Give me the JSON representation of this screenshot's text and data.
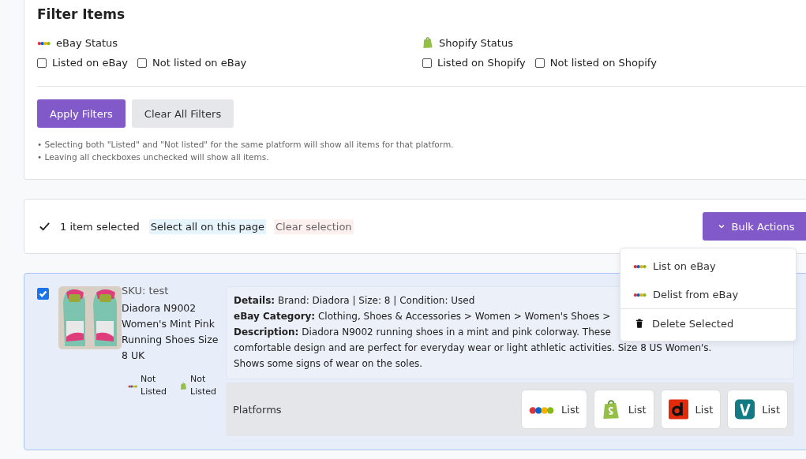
{
  "filter": {
    "title": "Filter Items",
    "groups": [
      {
        "kind": "ebay",
        "label": "eBay Status",
        "options": [
          {
            "label": "Listed on eBay",
            "checked": false
          },
          {
            "label": "Not listed on eBay",
            "checked": false
          }
        ]
      },
      {
        "kind": "shopify",
        "label": "Shopify Status",
        "options": [
          {
            "label": "Listed on Shopify",
            "checked": false
          },
          {
            "label": "Not listed on Shopify",
            "checked": false
          }
        ]
      }
    ],
    "buttons": [
      {
        "label": "Apply Filters",
        "kind": "primary"
      },
      {
        "label": "Clear All Filters",
        "kind": "secondary"
      }
    ],
    "notes": [
      "• Selecting both \"Listed\" and \"Not listed\" for the same platform will show all items for that platform.",
      "• Leaving all checkboxes unchecked will show all items."
    ]
  },
  "selection": {
    "count_text": "1 item selected",
    "select_all": "Select all on this page",
    "clear": "Clear selection",
    "bulk_button": "Bulk Actions",
    "expanded": true
  },
  "bulk_menu": [
    {
      "kind": "ebay",
      "label": "List on eBay"
    },
    {
      "kind": "ebay",
      "label": "Delist from eBay"
    },
    {
      "kind": "trash",
      "label": "Delete Selected"
    }
  ],
  "item": {
    "selected": true,
    "sku": "SKU: test",
    "title": "Diadora N9002 Women's Mint Pink Running Shoes Size 8 UK",
    "statuses": [
      {
        "kind": "ebay",
        "text": "Not Listed"
      },
      {
        "kind": "shopify",
        "text": "Not Listed"
      }
    ],
    "details": [
      "**Details:** Brand: Diadora | Size: 8 | Condition: Used",
      "**eBay Category:** Clothing, Shoes & Accessories > Women > Women's Shoes >",
      "**Description:** Diadora N9002 running shoes in a mint and pink colorway. These",
      "comfortable design and are perfect for everyday wear or light athletic activities. Size 8 US Women's.",
      "Shows some signs of wear on the soles."
    ],
    "platforms_label": "Platforms",
    "platforms": [
      {
        "kind": "ebay",
        "label": "List"
      },
      {
        "kind": "shopify",
        "label": "List"
      },
      {
        "kind": "depop",
        "label": "List"
      },
      {
        "kind": "vinted",
        "label": "List"
      }
    ]
  }
}
